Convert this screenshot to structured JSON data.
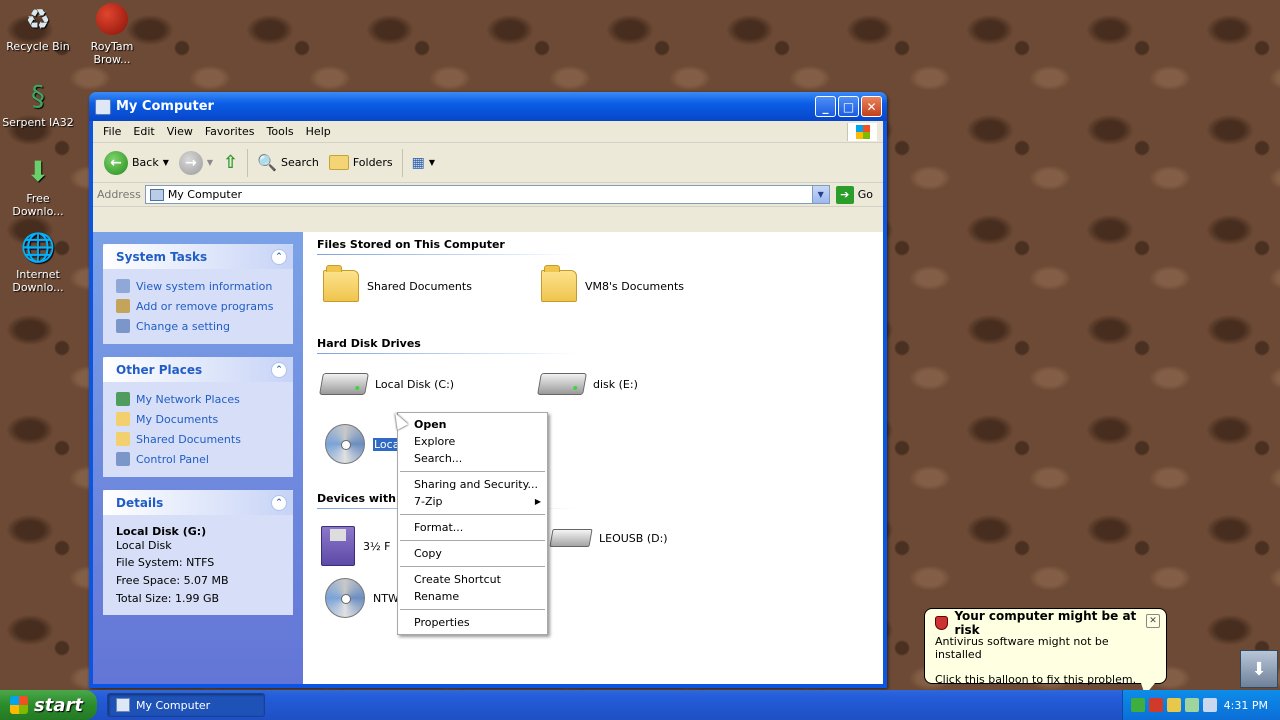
{
  "desktop": {
    "icons": [
      {
        "label": "Recycle Bin",
        "icon": "recycle-bin-icon"
      },
      {
        "label": "RoyTam Brow...",
        "icon": "browser-icon"
      },
      {
        "label": "Serpent IA32",
        "icon": "serpent-icon"
      },
      {
        "label": "Free Downlo...",
        "icon": "download-manager-icon"
      },
      {
        "label": "Internet Downlo...",
        "icon": "internet-download-icon"
      }
    ]
  },
  "window": {
    "title": "My Computer",
    "menu": [
      "File",
      "Edit",
      "View",
      "Favorites",
      "Tools",
      "Help"
    ],
    "toolbar": {
      "back": "Back",
      "search": "Search",
      "folders": "Folders"
    },
    "address": {
      "label": "Address",
      "value": "My Computer",
      "go": "Go"
    }
  },
  "taskpane": {
    "system_tasks": {
      "title": "System Tasks",
      "items": [
        "View system information",
        "Add or remove programs",
        "Change a setting"
      ]
    },
    "other_places": {
      "title": "Other Places",
      "items": [
        "My Network Places",
        "My Documents",
        "Shared Documents",
        "Control Panel"
      ]
    },
    "details": {
      "title": "Details",
      "name": "Local Disk (G:)",
      "type": "Local Disk",
      "file_system": "File System: NTFS",
      "free_space": "Free Space: 5.07 MB",
      "total_size": "Total Size: 1.99 GB"
    }
  },
  "content": {
    "groups": {
      "files_stored": "Files Stored on This Computer",
      "hard_disks": "Hard Disk Drives",
      "removable": "Devices with Removable Storage"
    },
    "files": [
      "Shared Documents",
      "VM8's Documents"
    ],
    "drives": [
      "Local Disk (C:)",
      "disk (E:)"
    ],
    "selected_drive_label": "Loca",
    "removable_items": [
      "3½ F",
      "LEOUSB (D:)",
      "NTW"
    ]
  },
  "context_menu": {
    "items": [
      {
        "label": "Open",
        "bold": true
      },
      {
        "label": "Explore"
      },
      {
        "label": "Search..."
      },
      {
        "sep": true
      },
      {
        "label": "Sharing and Security..."
      },
      {
        "label": "7-Zip",
        "submenu": true
      },
      {
        "sep": true
      },
      {
        "label": "Format..."
      },
      {
        "sep": true
      },
      {
        "label": "Copy"
      },
      {
        "sep": true
      },
      {
        "label": "Create Shortcut"
      },
      {
        "label": "Rename"
      },
      {
        "sep": true
      },
      {
        "label": "Properties"
      }
    ]
  },
  "balloon": {
    "title": "Your computer might be at risk",
    "line1": "Antivirus software might not be installed",
    "line2": "Click this balloon to fix this problem."
  },
  "taskbar": {
    "start": "start",
    "task_button": "My Computer",
    "clock": "4:31 PM"
  }
}
